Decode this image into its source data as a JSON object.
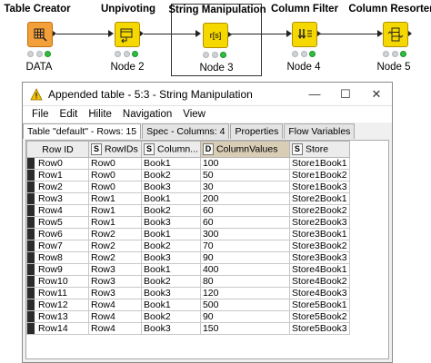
{
  "workflow": {
    "nodes": [
      {
        "title": "Table Creator",
        "label": "DATA",
        "icon": "table-creator-icon",
        "color": "#f3a03a"
      },
      {
        "title": "Unpivoting",
        "label": "Node 2",
        "icon": "unpivot-icon",
        "color": "#f5d800"
      },
      {
        "title": "String Manipulation",
        "label": "Node 3",
        "icon": "string-manipulation-icon",
        "color": "#f5d800",
        "icon_text": "r[s]"
      },
      {
        "title": "Column Filter",
        "label": "Node 4",
        "icon": "column-filter-icon",
        "color": "#f5d800"
      },
      {
        "title": "Column Resorter",
        "label": "Node 5",
        "icon": "column-resorter-icon",
        "color": "#f5d800"
      }
    ]
  },
  "window": {
    "title": "Appended table - 5:3 - String Manipulation",
    "controls": {
      "minimize": "—",
      "maximize": "☐",
      "close": "✕"
    },
    "menu": [
      "File",
      "Edit",
      "Hilite",
      "Navigation",
      "View"
    ],
    "tabs": [
      "Table \"default\" - Rows: 15",
      "Spec - Columns: 4",
      "Properties",
      "Flow Variables"
    ]
  },
  "table": {
    "columns": [
      {
        "type": "",
        "name": "Row ID"
      },
      {
        "type": "S",
        "name": "RowIDs"
      },
      {
        "type": "S",
        "name": "Column..."
      },
      {
        "type": "D",
        "name": "ColumnValues"
      },
      {
        "type": "S",
        "name": "Store"
      }
    ],
    "rows": [
      [
        "Row0",
        "Row0",
        "Book1",
        "100",
        "Store1Book1"
      ],
      [
        "Row1",
        "Row0",
        "Book2",
        "50",
        "Store1Book2"
      ],
      [
        "Row2",
        "Row0",
        "Book3",
        "30",
        "Store1Book3"
      ],
      [
        "Row3",
        "Row1",
        "Book1",
        "200",
        "Store2Book1"
      ],
      [
        "Row4",
        "Row1",
        "Book2",
        "60",
        "Store2Book2"
      ],
      [
        "Row5",
        "Row1",
        "Book3",
        "60",
        "Store2Book3"
      ],
      [
        "Row6",
        "Row2",
        "Book1",
        "300",
        "Store3Book1"
      ],
      [
        "Row7",
        "Row2",
        "Book2",
        "70",
        "Store3Book2"
      ],
      [
        "Row8",
        "Row2",
        "Book3",
        "90",
        "Store3Book3"
      ],
      [
        "Row9",
        "Row3",
        "Book1",
        "400",
        "Store4Book1"
      ],
      [
        "Row10",
        "Row3",
        "Book2",
        "80",
        "Store4Book2"
      ],
      [
        "Row11",
        "Row3",
        "Book3",
        "120",
        "Store4Book3"
      ],
      [
        "Row12",
        "Row4",
        "Book1",
        "500",
        "Store5Book1"
      ],
      [
        "Row13",
        "Row4",
        "Book2",
        "90",
        "Store5Book2"
      ],
      [
        "Row14",
        "Row4",
        "Book3",
        "150",
        "Store5Book3"
      ]
    ]
  }
}
